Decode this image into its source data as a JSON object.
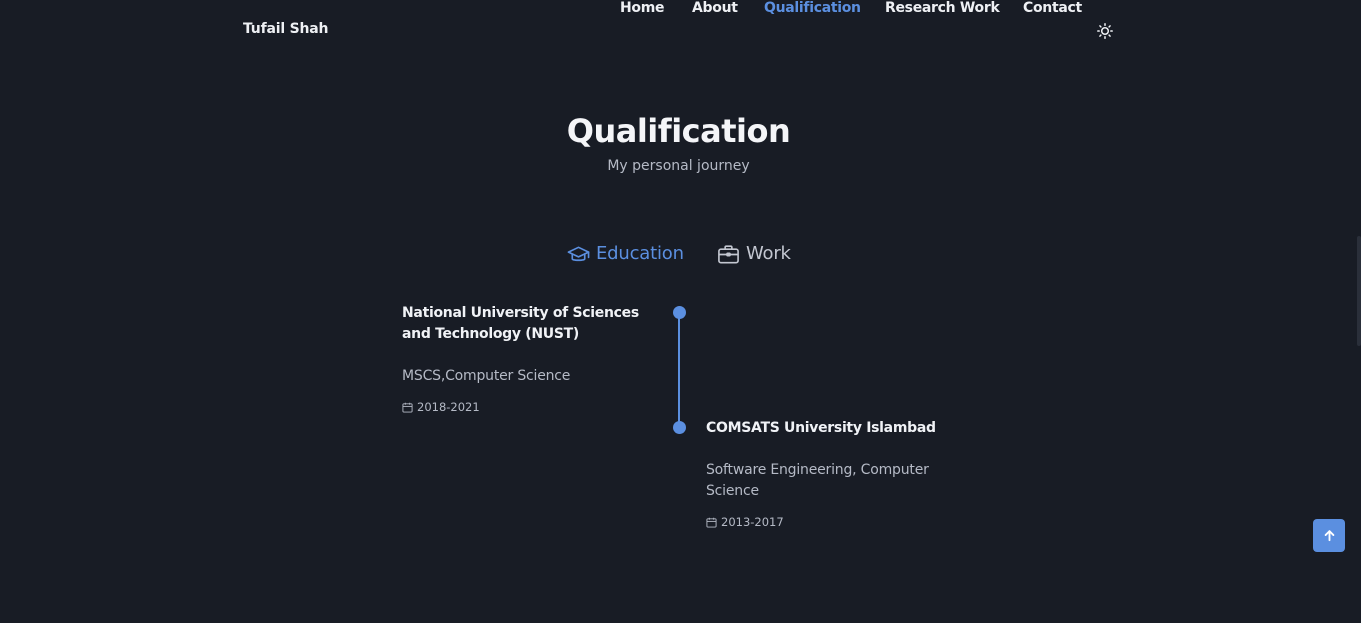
{
  "header": {
    "brand": "Tufail Shah",
    "nav": [
      {
        "label": "Home"
      },
      {
        "label": "About"
      },
      {
        "label": "Qualification",
        "active": true
      },
      {
        "label": "Research Work"
      },
      {
        "label": "Contact"
      }
    ],
    "theme_icon": "sun-icon"
  },
  "section": {
    "title": "Qualification",
    "subtitle": "My personal journey"
  },
  "tabs": [
    {
      "label": "Education",
      "icon": "graduation-cap-icon",
      "active": true
    },
    {
      "label": "Work",
      "icon": "briefcase-icon",
      "active": false
    }
  ],
  "timeline": [
    {
      "title": "National University of Sciences and Technology (NUST)",
      "subtitle": "MSCS,Computer Science",
      "date": "2018-2021",
      "icon": "calendar-icon"
    },
    {
      "title": "COMSATS University Islambad",
      "subtitle": "Software Engineering, Computer Science",
      "date": "2013-2017",
      "icon": "calendar-icon"
    }
  ],
  "colors": {
    "background": "#181c25",
    "accent": "#5b8fe0",
    "text": "#f0f1f4",
    "muted": "#b5bac6"
  },
  "scroll_up_icon": "arrow-up-icon"
}
